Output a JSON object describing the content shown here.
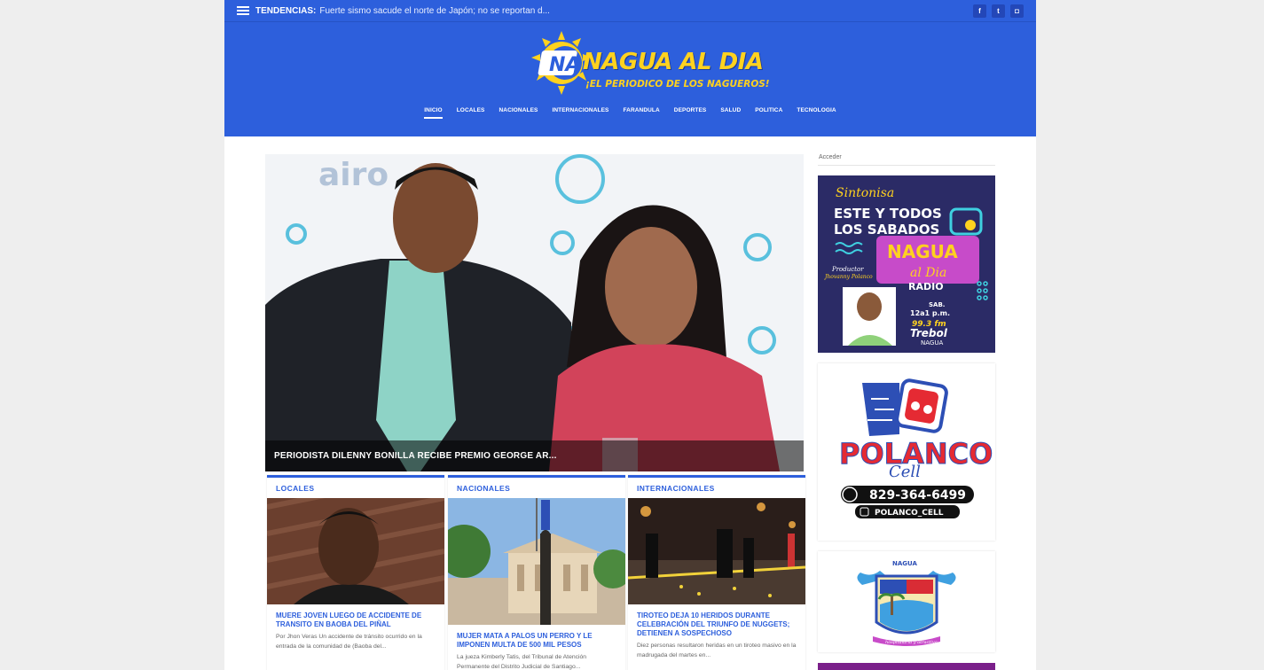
{
  "topbar": {
    "trend_label": "TENDENCIAS:",
    "trend_text": "Fuerte sismo sacude el norte de Japón; no se reportan d...",
    "socials": [
      {
        "icon": "facebook-icon",
        "glyph": "f"
      },
      {
        "icon": "twitter-icon",
        "glyph": "t"
      },
      {
        "icon": "instagram-icon",
        "glyph": "◘"
      }
    ]
  },
  "logo": {
    "badge": "NA",
    "title": "NAGUA AL DIA",
    "subtitle": "¡EL PERIODICO DE LOS NAGUEROS!"
  },
  "nav": {
    "items": [
      "INICIO",
      "LOCALES",
      "NACIONALES",
      "INTERNACIONALES",
      "FARANDULA",
      "DEPORTES",
      "SALUD",
      "POLITICA",
      "TECNOLOGIA"
    ],
    "active": "INICIO"
  },
  "hero": {
    "title": "PERIODISTA DILENNY BONILLA RECIBE PREMIO GEORGE AR..."
  },
  "cards": [
    {
      "category": "LOCALES",
      "title": "MUERE JOVEN LUEGO DE ACCIDENTE DE TRANSITO EN BAOBA DEL PIÑAL",
      "excerpt": "Por Jhon Veras Un accidente de tránsito ocurrido en la entrada de la comunidad de (Baoba del..."
    },
    {
      "category": "NACIONALES",
      "title": "MUJER MATA A PALOS UN PERRO Y LE IMPONEN MULTA DE 500 MIL PESOS",
      "excerpt": "La jueza Kimberly Tatis, del Tribunal de Atención Permanente del Distrito Judicial de Santiago..."
    },
    {
      "category": "INTERNACIONALES",
      "title": "TIROTEO DEJA 10 HERIDOS DURANTE CELEBRACIÓN DEL TRIUNFO DE NUGGETS; DETIENEN A SOSPECHOSO",
      "excerpt": "Diez personas resultaron heridas en un tiroteo masivo en la madrugada del martes en..."
    }
  ],
  "sidebar": {
    "login_label": "Acceder",
    "radio_ad": {
      "line1": "Sintonisa",
      "line2": "ESTE Y TODOS",
      "line3": "LOS SABADOS",
      "brand1": "NAGUA",
      "brand2": "al Dia",
      "radio": "RADIO",
      "producer_label": "Productor",
      "producer": "Jhovanny Polanco",
      "day": "SAB.",
      "time": "12a1 p.m.",
      "freq": "99.3 fm",
      "station": "Trebol",
      "station_sub": "NAGUA"
    },
    "polanco_ad": {
      "brand": "POLANCO",
      "script": "Cell",
      "phone": "829-364-6499",
      "handle": "POLANCO_CELL"
    },
    "coat": {
      "label": "NAGUA",
      "motto": "hospitalaria y atractiva"
    }
  },
  "colors": {
    "brand_blue": "#2d5fdc",
    "logo_yellow": "#ffd21f",
    "ad_purple": "#2b2b66"
  }
}
